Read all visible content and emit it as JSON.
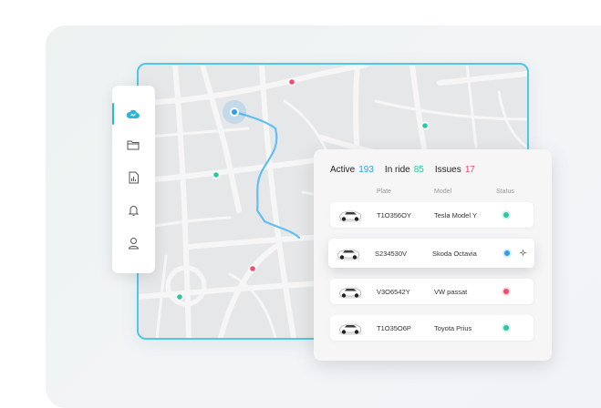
{
  "colors": {
    "accent": "#2bb6d8",
    "active": "#2f9ee8",
    "in_ride": "#2fc5a0",
    "issues": "#ee4d6f",
    "frame": "#4fc7e6",
    "route": "#62bff0"
  },
  "sidebar": {
    "items": [
      {
        "icon": "cloud-icon",
        "active": true
      },
      {
        "icon": "folder-icon",
        "active": false
      },
      {
        "icon": "chart-icon",
        "active": false
      },
      {
        "icon": "bell-icon",
        "active": false
      },
      {
        "icon": "user-icon",
        "active": false
      }
    ]
  },
  "stats": {
    "active_label": "Active",
    "active_value": "193",
    "in_ride_label": "In ride",
    "in_ride_value": "85",
    "issues_label": "Issues",
    "issues_value": "17"
  },
  "table": {
    "headers": {
      "plate": "Plate",
      "model": "Model",
      "status": "Status"
    },
    "rows": [
      {
        "plate": "T1O356OY",
        "model": "Tesla Model Y",
        "status": "in-ride",
        "status_color": "#2fc5a0",
        "icon": "car-icon"
      },
      {
        "plate": "S234530V",
        "model": "Skoda Octavia",
        "status": "active",
        "status_color": "#2f9ee8",
        "icon": "car-icon",
        "selected": true
      },
      {
        "plate": "V3O6542Y",
        "model": "VW passat",
        "status": "issue",
        "status_color": "#ee4d6f",
        "icon": "car-icon"
      },
      {
        "plate": "T1O35O6P",
        "model": "Toyota Prius",
        "status": "in-ride",
        "status_color": "#2fc5a0",
        "icon": "car-icon"
      }
    ]
  },
  "map": {
    "markers": [
      {
        "type": "issue",
        "color": "#ee4d6f"
      },
      {
        "type": "in-ride",
        "color": "#2fc5a0"
      },
      {
        "type": "in-ride",
        "color": "#2fc5a0"
      },
      {
        "type": "issue",
        "color": "#ee4d6f"
      },
      {
        "type": "in-ride",
        "color": "#2fc5a0"
      },
      {
        "type": "active-selected",
        "color": "#2f9ee8"
      }
    ]
  }
}
